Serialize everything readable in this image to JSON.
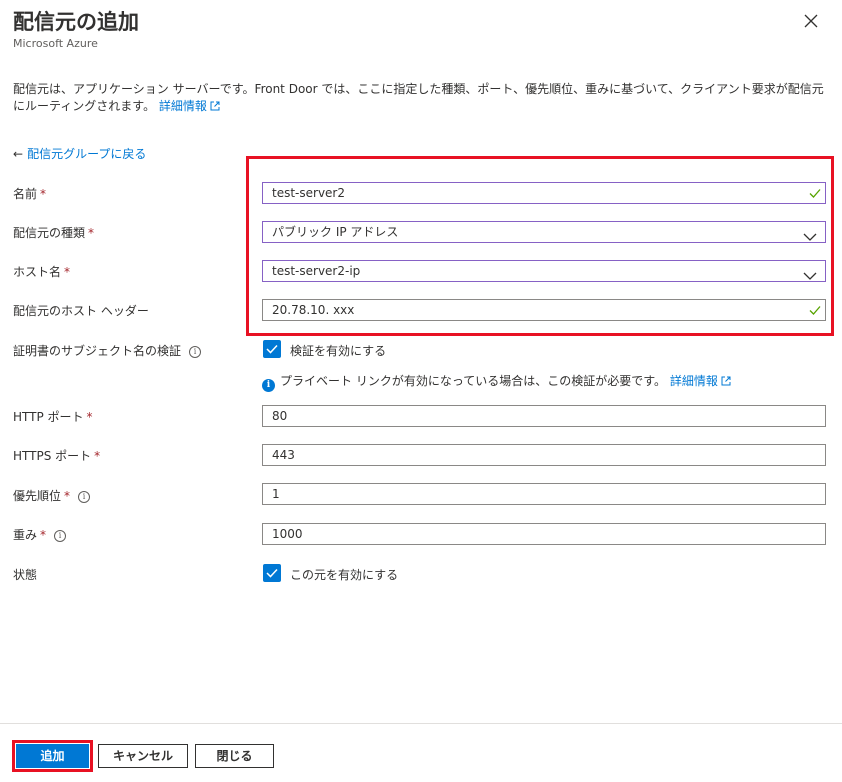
{
  "header": {
    "title": "配信元の追加",
    "subtitle": "Microsoft Azure",
    "close_icon": "close-icon"
  },
  "description": {
    "text": "配信元は、アプリケーション サーバーです。Front Door では、ここに指定した種類、ポート、優先順位、重みに基づいて、クライアント要求が配信元にルーティングされます。",
    "link": "詳細情報"
  },
  "back_link": {
    "arrow": "←",
    "label": "配信元グループに戻る"
  },
  "form": {
    "name": {
      "label": "名前",
      "required": "*",
      "value": "test-server2"
    },
    "origin_type": {
      "label": "配信元の種類",
      "required": "*",
      "value": "パブリック IP アドレス"
    },
    "host_name": {
      "label": "ホスト名",
      "required": "*",
      "value": "test-server2-ip"
    },
    "host_header": {
      "label": "配信元のホスト ヘッダー",
      "value": "20.78.10. xxx"
    },
    "cert_validation": {
      "label": "証明書のサブジェクト名の検証",
      "checkbox_label": "検証を有効にする",
      "checked": true,
      "info_text": "プライベート リンクが有効になっている場合は、この検証が必要です。",
      "info_link": "詳細情報"
    },
    "http_port": {
      "label": "HTTP ポート",
      "required": "*",
      "value": "80"
    },
    "https_port": {
      "label": "HTTPS ポート",
      "required": "*",
      "value": "443"
    },
    "priority": {
      "label": "優先順位",
      "required": "*",
      "value": "1"
    },
    "weight": {
      "label": "重み",
      "required": "*",
      "value": "1000"
    },
    "status": {
      "label": "状態",
      "checkbox_label": "この元を有効にする",
      "checked": true
    }
  },
  "footer": {
    "add_button": "追加",
    "cancel_button": "キャンセル",
    "close_button": "閉じる"
  },
  "colors": {
    "accent": "#0078d4",
    "highlight": "#e81123",
    "focus_border": "#8661c5",
    "valid_check": "#57a300",
    "required": "#a4262c"
  }
}
